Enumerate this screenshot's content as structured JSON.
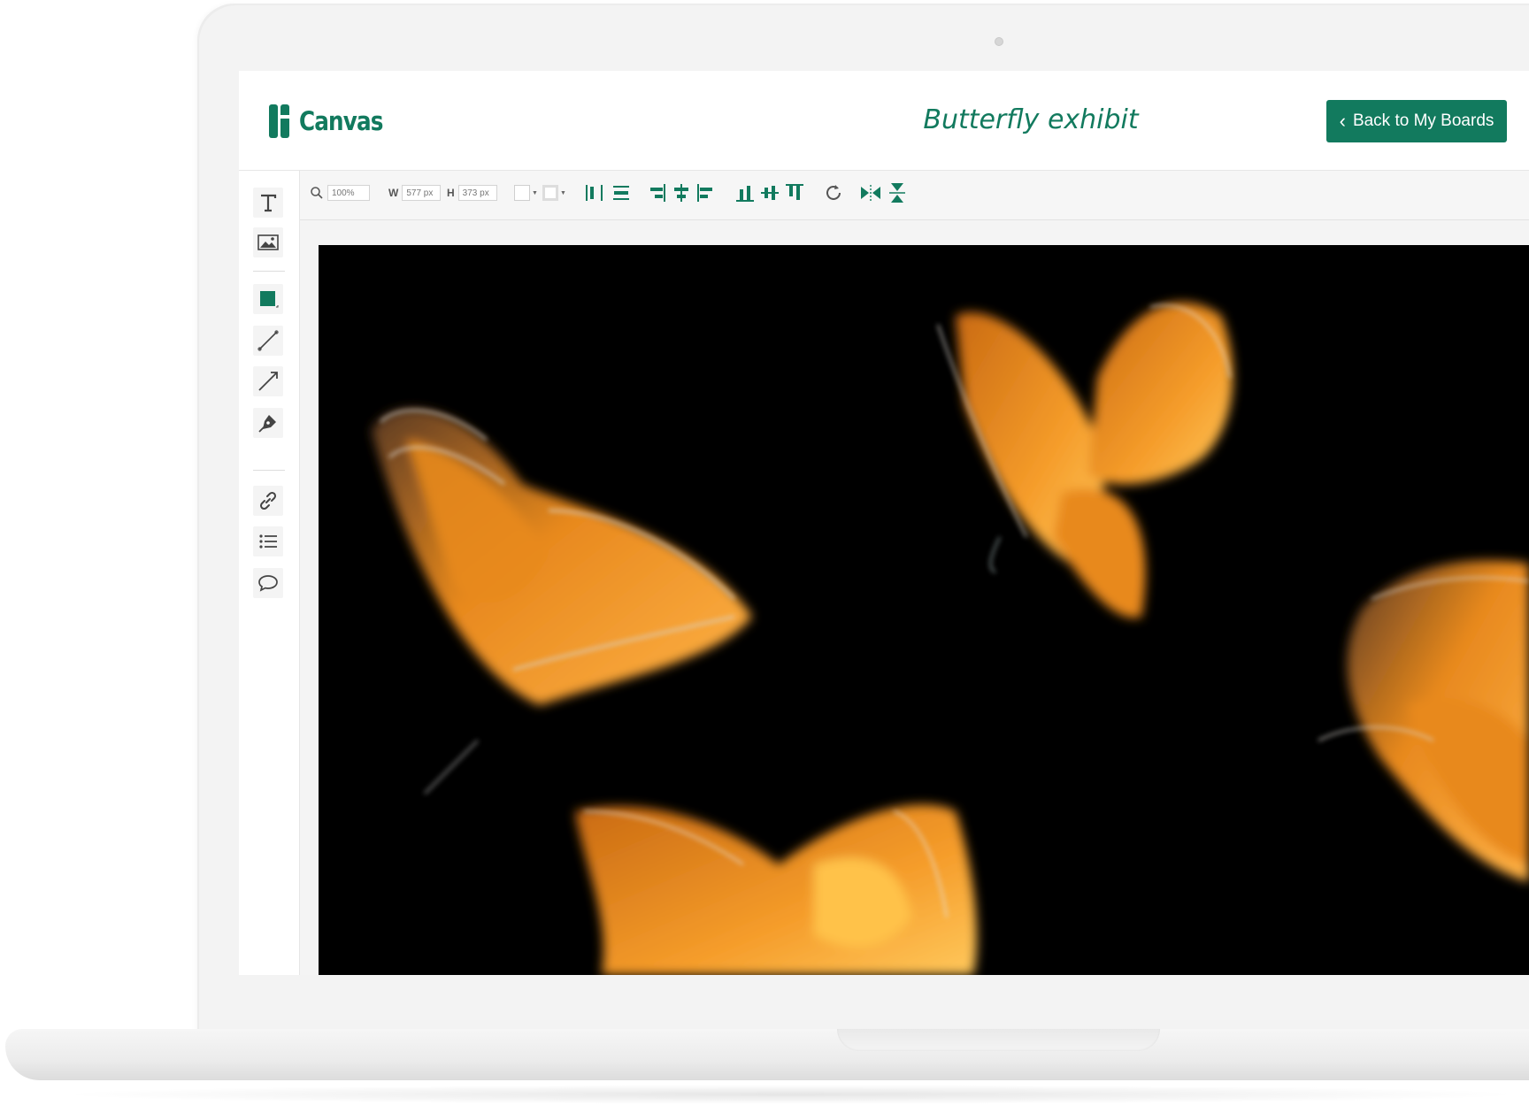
{
  "app": {
    "logo_text": "Canvas",
    "board_title": "Butterfly exhibit",
    "back_button_label": "Back to My Boards"
  },
  "toolbar": {
    "zoom_value": "100%",
    "width_label": "W",
    "width_value": "577 px",
    "height_label": "H",
    "height_value": "373 px"
  },
  "icons": {
    "tools": [
      "text-icon",
      "image-icon",
      "shape-icon",
      "line-icon",
      "arrow-icon",
      "pen-icon",
      "link-icon",
      "list-icon",
      "comment-icon"
    ],
    "toolbar": [
      "zoom-icon",
      "fill-color-icon",
      "border-color-icon",
      "align-left-icon",
      "align-center-vertical-icon",
      "align-right-icon",
      "align-center-horizontal-icon",
      "align-left-edge-icon",
      "align-bottom-icon",
      "align-middle-icon",
      "align-top-icon",
      "rotate-icon",
      "flip-horizontal-icon",
      "flip-vertical-icon"
    ]
  },
  "colors": {
    "brand": "#127a5e",
    "canvas_background": "#000000",
    "butterfly_orange": "#e8891e"
  }
}
